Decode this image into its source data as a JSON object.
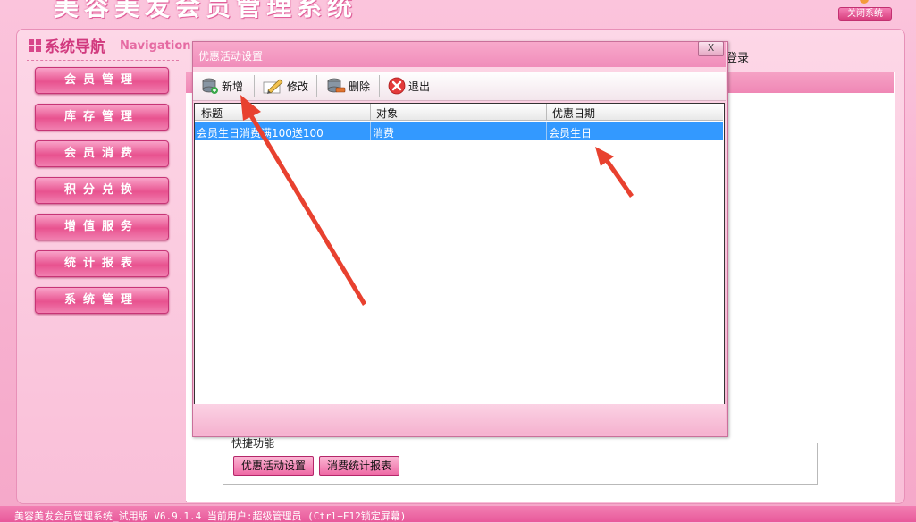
{
  "banner": {
    "title": "美容美发会员管理系统",
    "close_label": "关闭系统"
  },
  "nav": {
    "title": "系统导航",
    "title_en": "Navigation",
    "items": [
      {
        "label": "会员管理"
      },
      {
        "label": "库存管理"
      },
      {
        "label": "会员消费"
      },
      {
        "label": "积分兑换"
      },
      {
        "label": "增值服务"
      },
      {
        "label": "统计报表"
      },
      {
        "label": "系统管理"
      }
    ]
  },
  "content": {
    "login_text": "登录"
  },
  "dialog": {
    "title": "优惠活动设置",
    "close_glyph": "X",
    "toolbar": {
      "add": "新增",
      "edit": "修改",
      "delete": "删除",
      "exit": "退出"
    },
    "grid": {
      "columns": [
        "标题",
        "对象",
        "优惠日期"
      ],
      "rows": [
        {
          "title": "会员生日消费满100送100",
          "target": "消费",
          "date": "会员生日"
        }
      ]
    }
  },
  "quick": {
    "title": "快捷功能",
    "buttons": [
      "优惠活动设置",
      "消费统计报表"
    ]
  },
  "status": {
    "text": "美容美发会员管理系统_试用版 V6.9.1.4 当前用户:超级管理员 (Ctrl+F12锁定屏幕)"
  },
  "colors": {
    "accent": "#e8528f",
    "selection": "#3399ff",
    "arrow": "#e8412f"
  }
}
